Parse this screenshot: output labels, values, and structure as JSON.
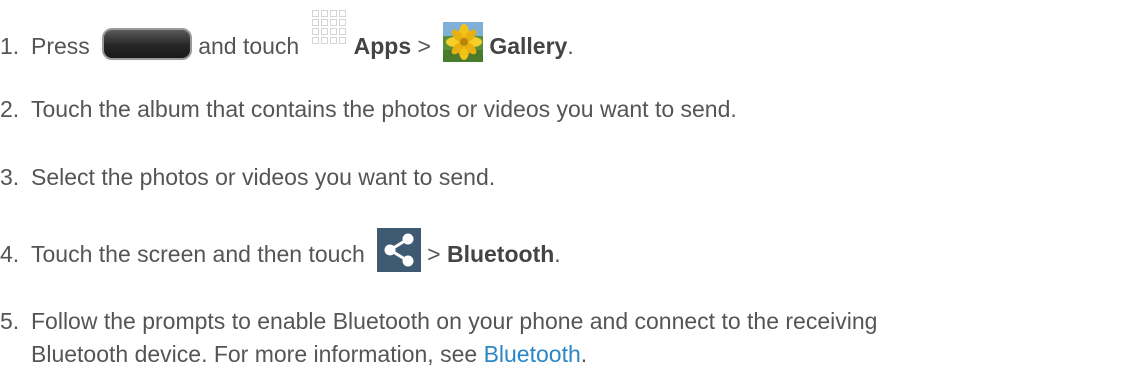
{
  "steps": [
    {
      "number": "1.",
      "parts": {
        "press": "Press",
        "and_touch": "and touch",
        "apps": "Apps",
        "sep": ">",
        "gallery": "Gallery",
        "end": "."
      }
    },
    {
      "number": "2.",
      "text": "Touch the album that contains the photos or videos you want to send."
    },
    {
      "number": "3.",
      "text": "Select the photos or videos you want to send."
    },
    {
      "number": "4.",
      "parts": {
        "text": "Touch the screen and then touch",
        "sep": ">",
        "bluetooth": "Bluetooth",
        "end": "."
      }
    },
    {
      "number": "5.",
      "line1": "Follow the prompts to enable Bluetooth on your phone and connect to the receiving",
      "line2_prefix": "Bluetooth device. For more information, see",
      "link": "Bluetooth",
      "end": "."
    }
  ],
  "icons": {
    "home_key": "home-key-icon",
    "apps": "apps-grid-icon",
    "gallery": "gallery-icon",
    "share": "share-icon"
  },
  "colors": {
    "text": "#555555",
    "link": "#2a86c4",
    "share_bg": "#3d5a72"
  }
}
